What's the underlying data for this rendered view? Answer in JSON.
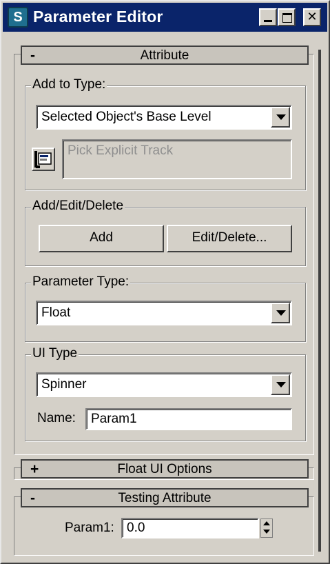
{
  "window": {
    "title": "Parameter Editor",
    "icon_glyph": "S",
    "icon_name": "app-logo-icon",
    "buttons": {
      "minimize": "minimize-icon",
      "maximize": "maximize-icon",
      "close": "✕"
    }
  },
  "rollouts": {
    "attribute": {
      "sign": "-",
      "label": "Attribute",
      "add_to_type": {
        "label": "Add to Type:",
        "selected": "Selected Object's Base Level",
        "pick_placeholder": "Pick Explicit Track"
      },
      "add_edit_delete": {
        "label": "Add/Edit/Delete",
        "add_label": "Add",
        "edit_delete_label": "Edit/Delete..."
      },
      "parameter_type": {
        "label": "Parameter Type:",
        "selected": "Float"
      },
      "ui_type": {
        "label": "UI Type",
        "selected": "Spinner",
        "name_label": "Name:",
        "name_value": "Param1"
      }
    },
    "float_ui_options": {
      "sign": "+",
      "label": "Float UI Options"
    },
    "testing_attribute": {
      "sign": "-",
      "label": "Testing Attribute",
      "param_label": "Param1:",
      "param_value": "0.0"
    }
  },
  "colors": {
    "titlebar": "#0a246a",
    "face": "#d4d0c8",
    "disabled_text": "#8f8f8f"
  }
}
